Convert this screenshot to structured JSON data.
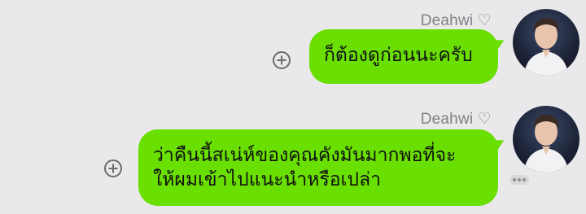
{
  "messages": [
    {
      "sender": "Deahwi ♡",
      "lines": [
        "ก็ต้องดูก่อนนะครับ"
      ]
    },
    {
      "sender": "Deahwi ♡",
      "lines": [
        "ว่าคืนนี้สเน่ห์ของคุณคังมันมากพอที่จะ",
        "ให้ผมเข้าไปแนะนำหรือเปล่า"
      ]
    }
  ],
  "colors": {
    "background": "#e9e9eb",
    "bubble": "#6adf02",
    "sender_text": "#7f8183"
  },
  "icons": {
    "add": "plus-circle-icon",
    "more": "more-dots-icon"
  }
}
